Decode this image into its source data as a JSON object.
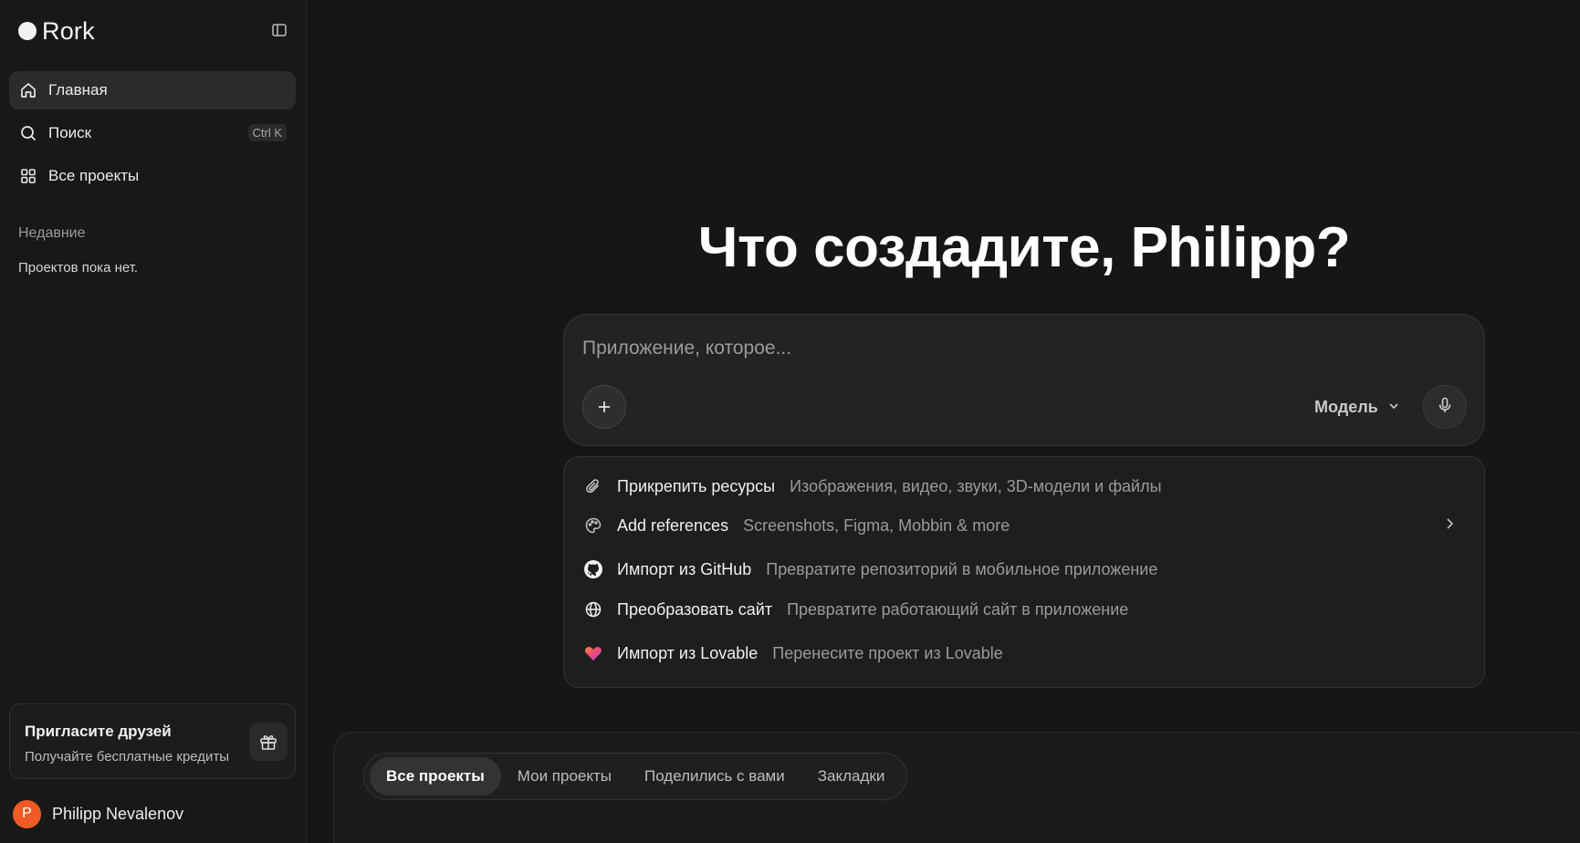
{
  "brand": {
    "name": "Rork"
  },
  "sidebar": {
    "nav": [
      {
        "label": "Главная",
        "icon": "home-icon"
      },
      {
        "label": "Поиск",
        "icon": "search-icon",
        "shortcut": "Ctrl K"
      },
      {
        "label": "Все проекты",
        "icon": "grid-icon"
      }
    ],
    "recent_title": "Недавние",
    "recent_empty": "Проектов пока нет.",
    "invite": {
      "title": "Пригласите друзей",
      "subtitle": "Получайте бесплатные кредиты"
    },
    "user": {
      "initial": "P",
      "name": "Philipp Nevalenov",
      "avatar_color": "#f05a24"
    }
  },
  "main": {
    "heading": "Что создадите, Philipp?",
    "prompt": {
      "placeholder": "Приложение, которое...",
      "model_label": "Модель"
    },
    "options": [
      {
        "title": "Прикрепить ресурсы",
        "desc": "Изображения, видео, звуки, 3D-модели и файлы",
        "icon": "paperclip-icon"
      },
      {
        "title": "Add references",
        "desc": "Screenshots, Figma, Mobbin & more",
        "icon": "palette-icon"
      },
      {
        "title": "Импорт из GitHub",
        "desc": "Превратите репозиторий в мобильное приложение",
        "icon": "github-icon"
      },
      {
        "title": "Преобразовать сайт",
        "desc": "Превратите работающий сайт в приложение",
        "icon": "globe-icon"
      },
      {
        "title": "Импорт из Lovable",
        "desc": "Перенесите проект из Lovable",
        "icon": "lovable-heart-icon"
      }
    ],
    "project_tabs": [
      {
        "label": "Все проекты",
        "active": true
      },
      {
        "label": "Мои проекты",
        "active": false
      },
      {
        "label": "Поделились с вами",
        "active": false
      },
      {
        "label": "Закладки",
        "active": false
      }
    ]
  }
}
